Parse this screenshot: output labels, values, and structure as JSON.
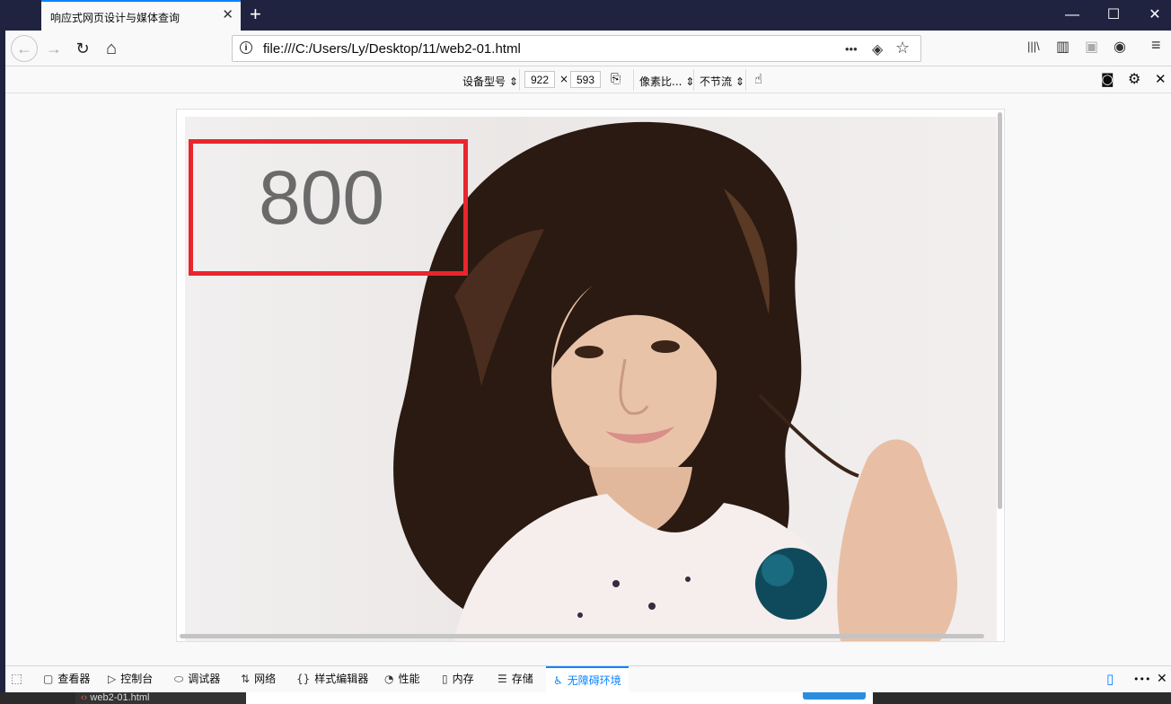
{
  "browser": {
    "tab_title": "响应式网页设计与媒体查询",
    "tab_close": "✕",
    "new_tab": "+",
    "url": "file:///C:/Users/Ly/Desktop/11/web2-01.html",
    "window_controls": {
      "minimize": "—",
      "maximize": "☐",
      "close": "✕"
    }
  },
  "navbar": {
    "back_icon": "←",
    "forward_icon": "→",
    "reload_icon": "↻",
    "home_icon": "⌂",
    "page_actions_icon": "•••",
    "pocket_icon": "◈",
    "bookmark_icon": "☆",
    "library_icon": "|||\\",
    "sidebar_icon": "▥",
    "extension_icon": "▣",
    "account_icon": "◉",
    "menu_icon": "≡"
  },
  "rdm": {
    "device_label": "设备型号",
    "width": "922",
    "times": "×",
    "height": "593",
    "dpr_label": "像素比...",
    "throttle_label": "不节流"
  },
  "page": {
    "annotation_number": "800"
  },
  "devtools": {
    "tabs": [
      {
        "label": "查看器",
        "icon": "▢"
      },
      {
        "label": "控制台",
        "icon": "▷"
      },
      {
        "label": "调试器",
        "icon": "⬭"
      },
      {
        "label": "网络",
        "icon": "⇅"
      },
      {
        "label": "样式编辑器",
        "icon": "{}"
      },
      {
        "label": "性能",
        "icon": "◔"
      },
      {
        "label": "内存",
        "icon": "▯"
      },
      {
        "label": "存储",
        "icon": "☰"
      },
      {
        "label": "无障碍环境",
        "icon": "♿"
      }
    ],
    "more_icon": "•••",
    "close_icon": "✕"
  },
  "taskbar": {
    "file_name": "web2-01.html"
  },
  "colors": {
    "titlebar": "#202340",
    "accent": "#0a84ff",
    "annotation_red": "#e8262c"
  }
}
